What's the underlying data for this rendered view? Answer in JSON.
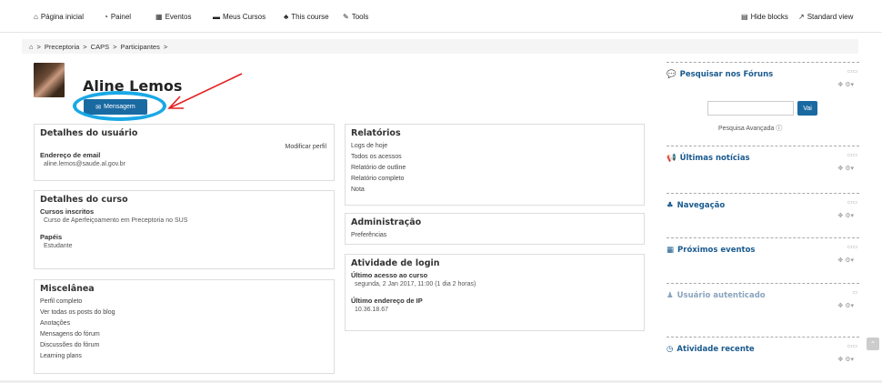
{
  "nav": {
    "home": "Página inicial",
    "dashboard": "Painel",
    "events": "Eventos",
    "my_courses": "Meus Cursos",
    "this_course": "This course",
    "tools": "Tools",
    "hide_blocks": "Hide blocks",
    "standard_view": "Standard view"
  },
  "breadcrumb": {
    "items": [
      "Preceptoria",
      "CAPS",
      "Participantes"
    ],
    "separator": ">"
  },
  "profile": {
    "name": "Aline Lemos",
    "message_button": "Mensagem"
  },
  "user_details": {
    "title": "Detalhes do usuário",
    "edit_link": "Modificar perfil",
    "email_label": "Endereço de email",
    "email_value": "aline.lemos@saude.al.gov.br"
  },
  "course_details": {
    "title": "Detalhes do curso",
    "enrolled_label": "Cursos inscritos",
    "enrolled_value": "Curso de Aperfeiçoamento em Preceptoria no SUS",
    "roles_label": "Papéis",
    "roles_value": "Estudante"
  },
  "misc": {
    "title": "Miscelânea",
    "links": [
      "Perfil completo",
      "Ver todas os posts do blog",
      "Anotações",
      "Mensagens do fórum",
      "Discussões do fórum",
      "Learning plans"
    ]
  },
  "reports": {
    "title": "Relatórios",
    "links": [
      "Logs de hoje",
      "Todos os acessos",
      "Relatório de outline",
      "Relatório completo",
      "Nota"
    ]
  },
  "admin": {
    "title": "Administração",
    "links": [
      "Preferências"
    ]
  },
  "login": {
    "title": "Atividade de login",
    "last_access_label": "Último acesso ao curso",
    "last_access_value": "segunda, 2 Jan 2017, 11:00  (1 dia 2 horas)",
    "last_ip_label": "Último endereço de IP",
    "last_ip_value": "10.36.18.67"
  },
  "sidebar": {
    "search_forums": "Pesquisar nos Fóruns",
    "go_button": "Vai",
    "advanced_search": "Pesquisa Avançada",
    "latest_news": "Últimas notícias",
    "navigation": "Navegação",
    "upcoming_events": "Próximos eventos",
    "logged_user": "Usuário autenticado",
    "recent_activity": "Atividade recente"
  },
  "colors": {
    "accent": "#1a6aa2",
    "ring": "#19a8e6",
    "arrow": "#e62020"
  }
}
